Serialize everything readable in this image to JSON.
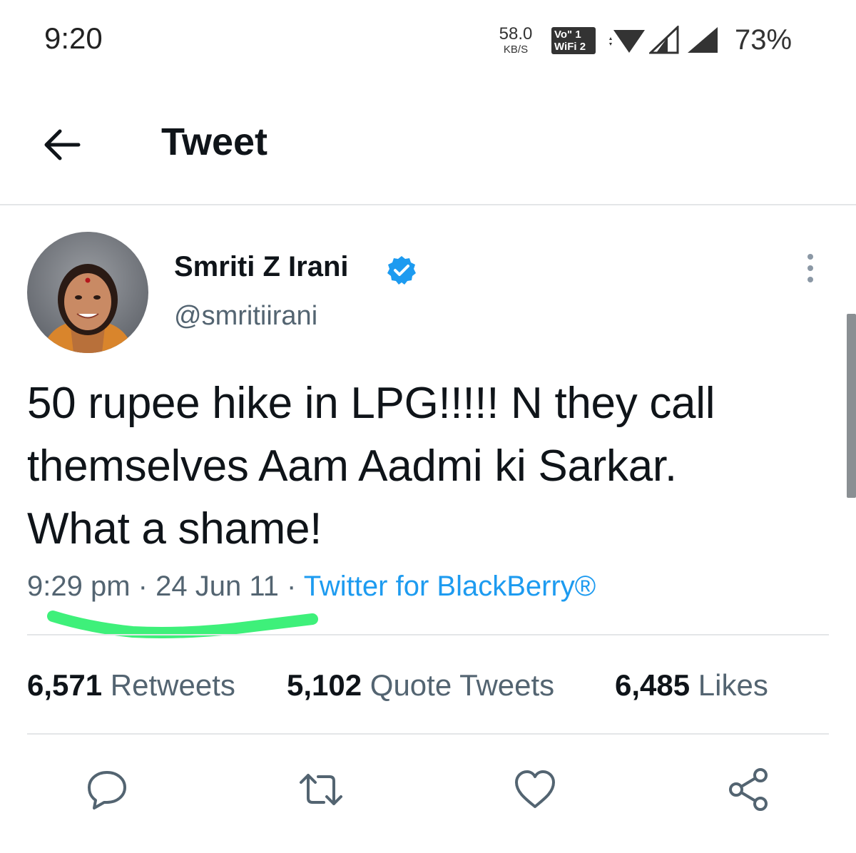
{
  "status_bar": {
    "time": "9:20",
    "net_speed_value": "58.0",
    "net_speed_unit": "KB/S",
    "volte_top": "Vo\" 1",
    "volte_bottom": "WiFi 2",
    "battery": "73%",
    "icons": [
      "wifi-icon",
      "signal-icon",
      "signal-icon"
    ]
  },
  "header": {
    "back_icon": "arrow-left-icon",
    "title": "Tweet"
  },
  "tweet": {
    "author_name": "Smriti Z Irani",
    "verified_icon": "verified-badge-icon",
    "handle": "@smritiirani",
    "text_line1": "50 rupee hike in LPG!!!!! N they call",
    "text_line2": "themselves Aam Aadmi ki Sarkar.",
    "text_line3": "What a shame!",
    "time": "9:29 pm",
    "separator": "·",
    "date": "24 Jun 11",
    "source": "Twitter for BlackBerry®",
    "highlight_color": "#3ef07a"
  },
  "stats": {
    "retweets_count": "6,571",
    "retweets_label": "Retweets",
    "quotes_count": "5,102",
    "quotes_label": "Quote Tweets",
    "likes_count": "6,485",
    "likes_label": "Likes"
  },
  "actions": [
    "reply-icon",
    "retweet-icon",
    "like-icon",
    "share-icon"
  ],
  "colors": {
    "text_primary": "#0f1419",
    "text_secondary": "#536471",
    "link": "#1d9bf0",
    "verified": "#1d9bf0"
  }
}
